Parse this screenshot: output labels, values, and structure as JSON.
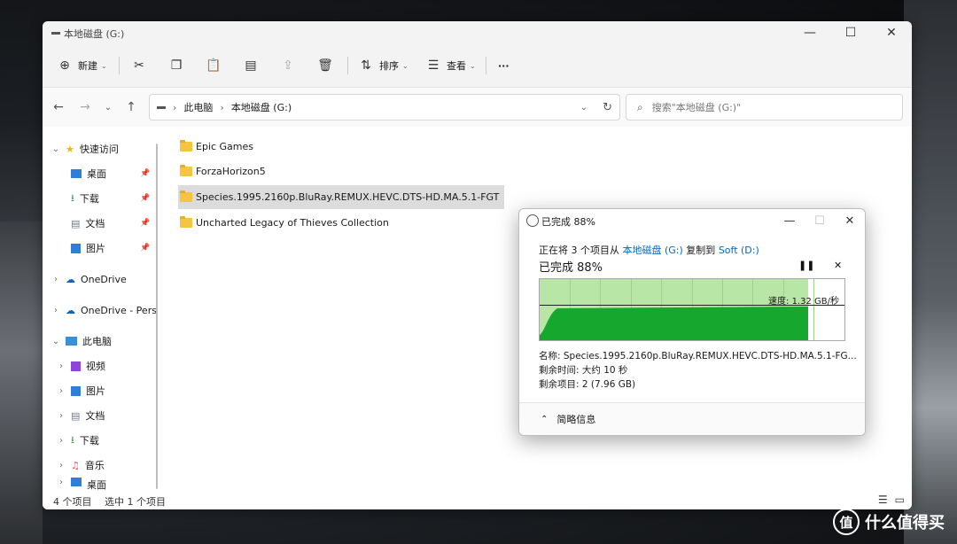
{
  "window": {
    "title": "本地磁盘 (G:)"
  },
  "toolbar": {
    "new_label": "新建",
    "sort_label": "排序",
    "view_label": "查看",
    "more_label": "···"
  },
  "address": {
    "segment1": "此电脑",
    "segment2": "本地磁盘 (G:)"
  },
  "search": {
    "placeholder": "搜索\"本地磁盘 (G:)\""
  },
  "sidebar": {
    "quick_access": "快速访问",
    "desktop": "桌面",
    "downloads": "下载",
    "documents": "文档",
    "pictures": "图片",
    "onedrive": "OneDrive",
    "onedrive_personal": "OneDrive - Pers",
    "this_pc": "此电脑",
    "videos": "视频",
    "pictures2": "图片",
    "documents2": "文档",
    "downloads2": "下载",
    "music": "音乐",
    "desktop2": "桌面"
  },
  "files": [
    "Epic Games",
    "ForzaHorizon5",
    "Species.1995.2160p.BluRay.REMUX.HEVC.DTS-HD.MA.5.1-FGT",
    "Uncharted Legacy of Thieves Collection"
  ],
  "status": {
    "item_count": "4 个项目",
    "selected": "选中 1 个项目"
  },
  "dialog": {
    "title": "已完成 88%",
    "line_prefix": "正在将 3 个项目从 ",
    "source": "本地磁盘 (G:)",
    "line_mid": " 复制到 ",
    "dest": "Soft (D:)",
    "progress_text": "已完成 88%",
    "progress_fraction": 0.88,
    "speed": "速度: 1.32 GB/秒",
    "name_line": "名称:  Species.1995.2160p.BluRay.REMUX.HEVC.DTS-HD.MA.5.1-FG...",
    "time_left": "剩余时间:  大约 10 秒",
    "items_left": "剩余项目:  2 (7.96 GB)",
    "less_details": "简略信息"
  },
  "watermark": {
    "badge": "值",
    "text": "什么值得买"
  }
}
